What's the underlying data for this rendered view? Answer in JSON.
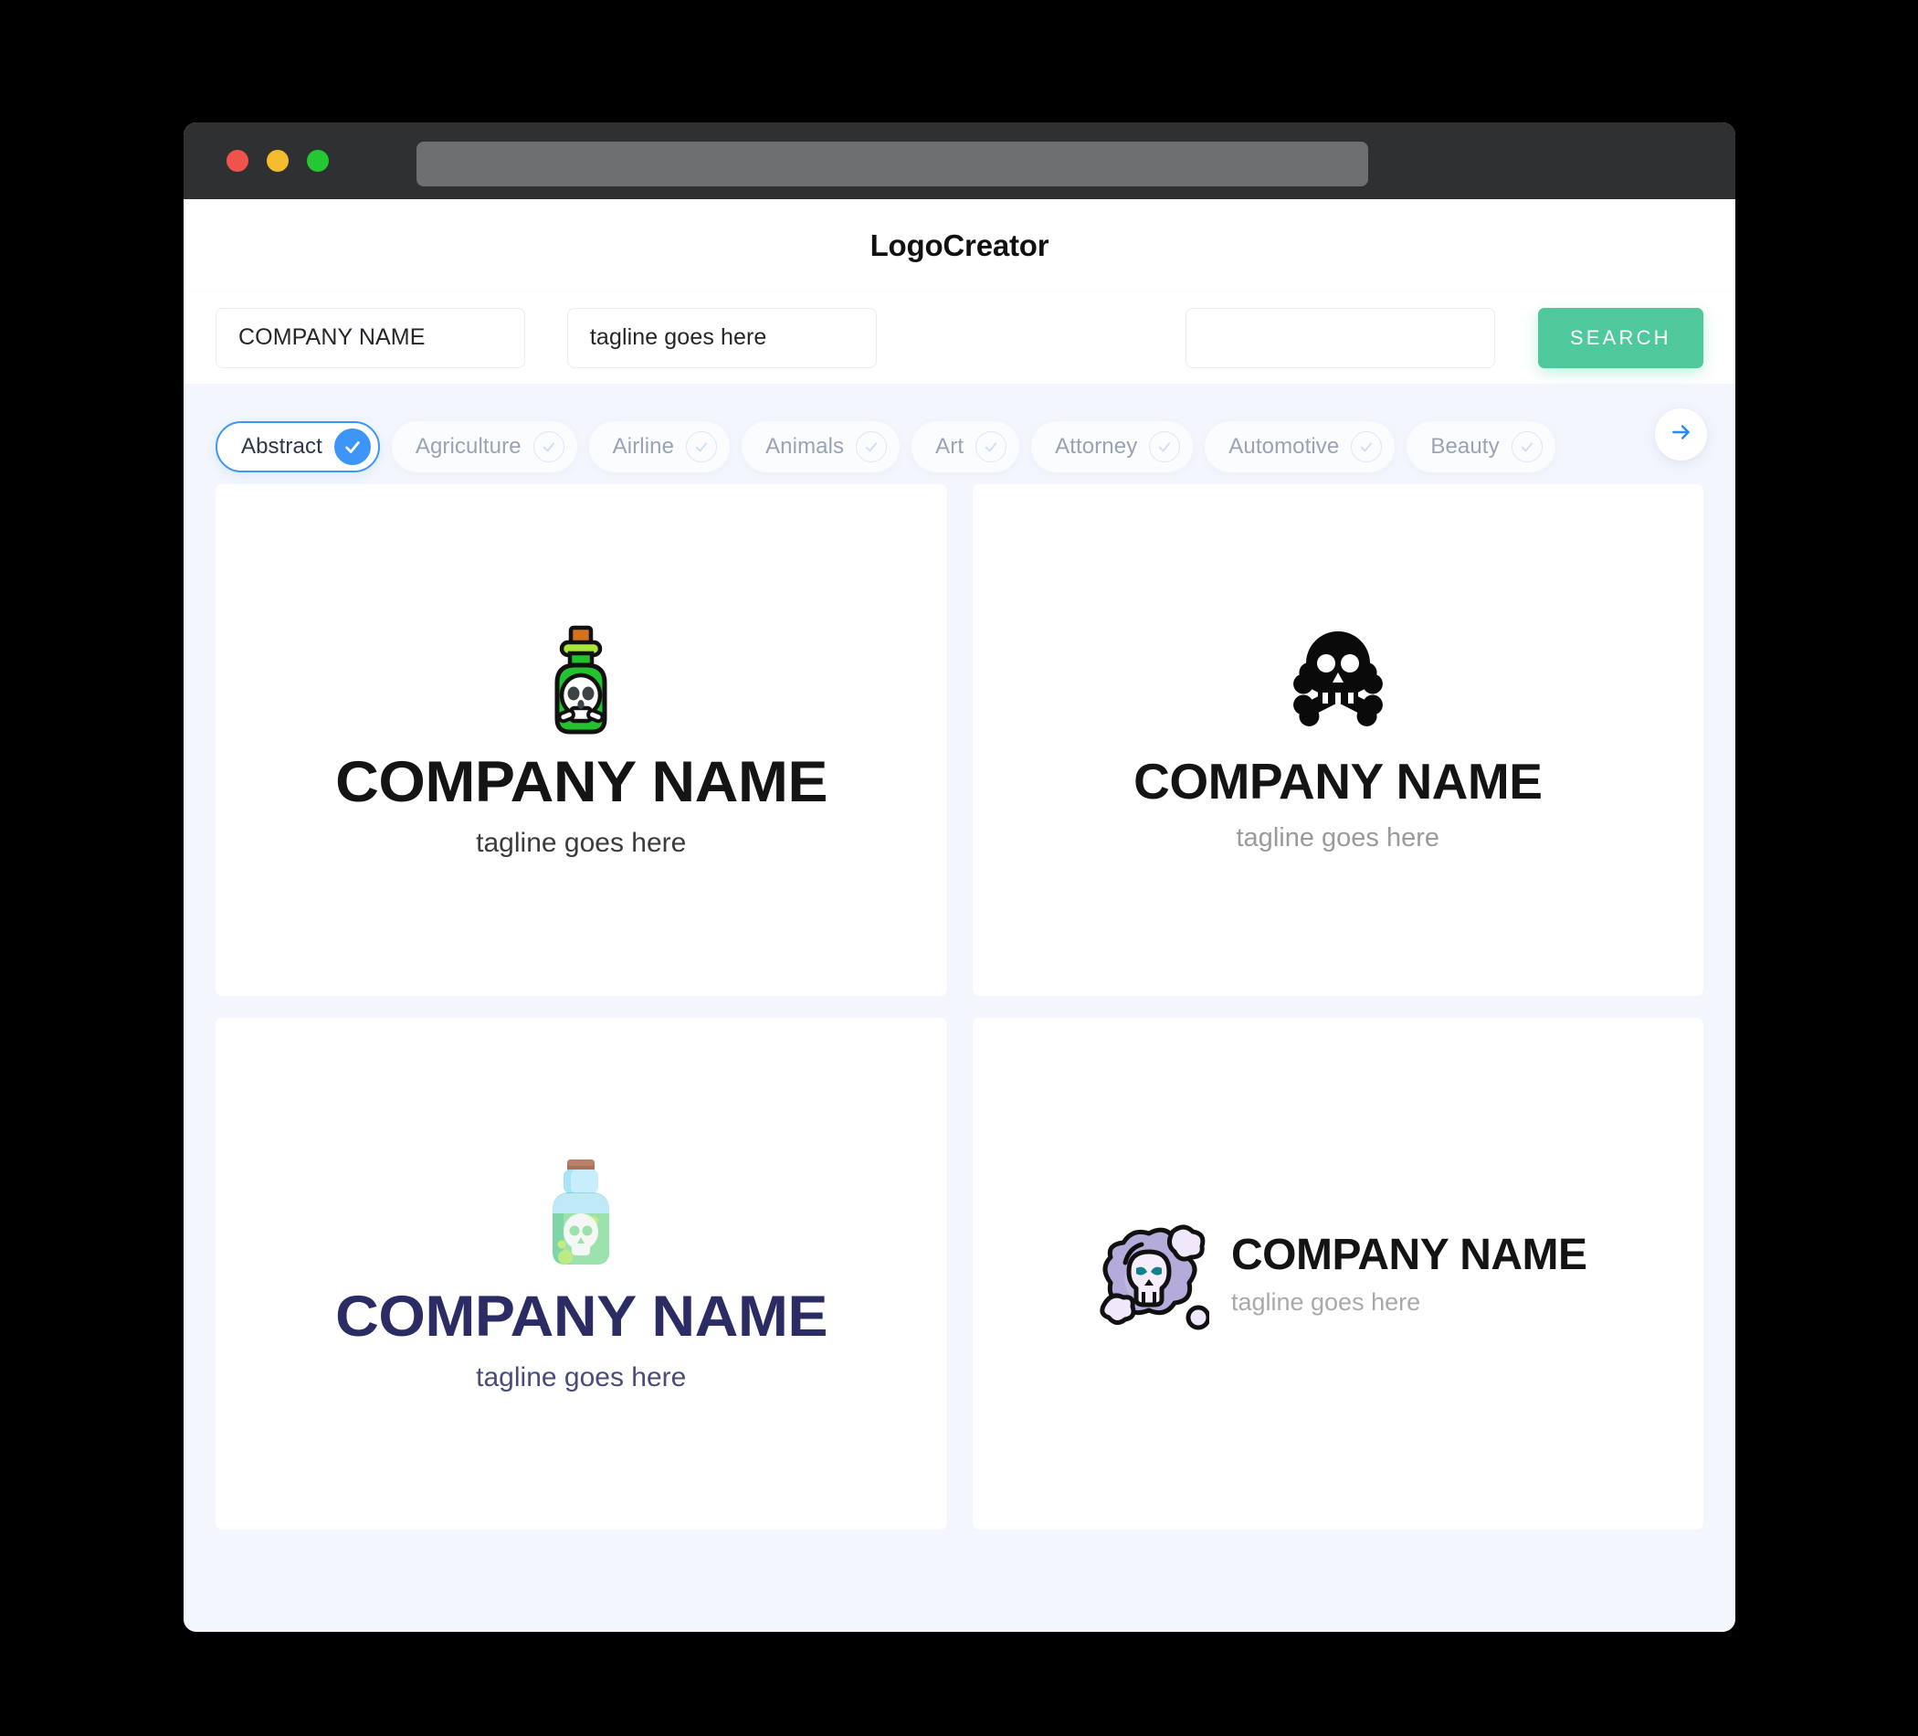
{
  "window": {
    "traffic_lights": [
      "close-red",
      "minimize-yellow",
      "maximize-green"
    ],
    "url_value": ""
  },
  "header": {
    "title": "LogoCreator"
  },
  "search": {
    "company_value": "COMPANY NAME",
    "tagline_value": "tagline goes here",
    "extra_value": "",
    "search_label": "SEARCH"
  },
  "categories": {
    "next_icon": "arrow-right-icon",
    "items": [
      {
        "label": "Abstract",
        "selected": true
      },
      {
        "label": "Agriculture",
        "selected": false
      },
      {
        "label": "Airline",
        "selected": false
      },
      {
        "label": "Animals",
        "selected": false
      },
      {
        "label": "Art",
        "selected": false
      },
      {
        "label": "Attorney",
        "selected": false
      },
      {
        "label": "Automotive",
        "selected": false
      },
      {
        "label": "Beauty",
        "selected": false
      }
    ]
  },
  "results": [
    {
      "icon": "green-poison-bottle-icon",
      "name": "COMPANY NAME",
      "tagline": "tagline goes here",
      "layout": "stacked",
      "name_color": "#141414",
      "tagline_color": "#3b3b3b"
    },
    {
      "icon": "skull-and-crossbones-icon",
      "name": "COMPANY NAME",
      "tagline": "tagline goes here",
      "layout": "stacked",
      "name_color": "#141414",
      "tagline_color": "#9a9a9a"
    },
    {
      "icon": "teal-potion-bottle-icon",
      "name": "COMPANY NAME",
      "tagline": "tagline goes here",
      "layout": "stacked",
      "name_color": "#2b2c63",
      "tagline_color": "#4a4b7a"
    },
    {
      "icon": "purple-skull-cloud-icon",
      "name": "COMPANY NAME",
      "tagline": "tagline goes here",
      "layout": "horizontal",
      "name_color": "#141414",
      "tagline_color": "#a9a9a9"
    }
  ],
  "colors": {
    "page_background": "#000000",
    "titlebar": "#2f3031",
    "content_background": "#f3f6fd",
    "card_background": "#ffffff",
    "accent_green": "#4fc99b",
    "accent_blue": "#3d96f7"
  }
}
